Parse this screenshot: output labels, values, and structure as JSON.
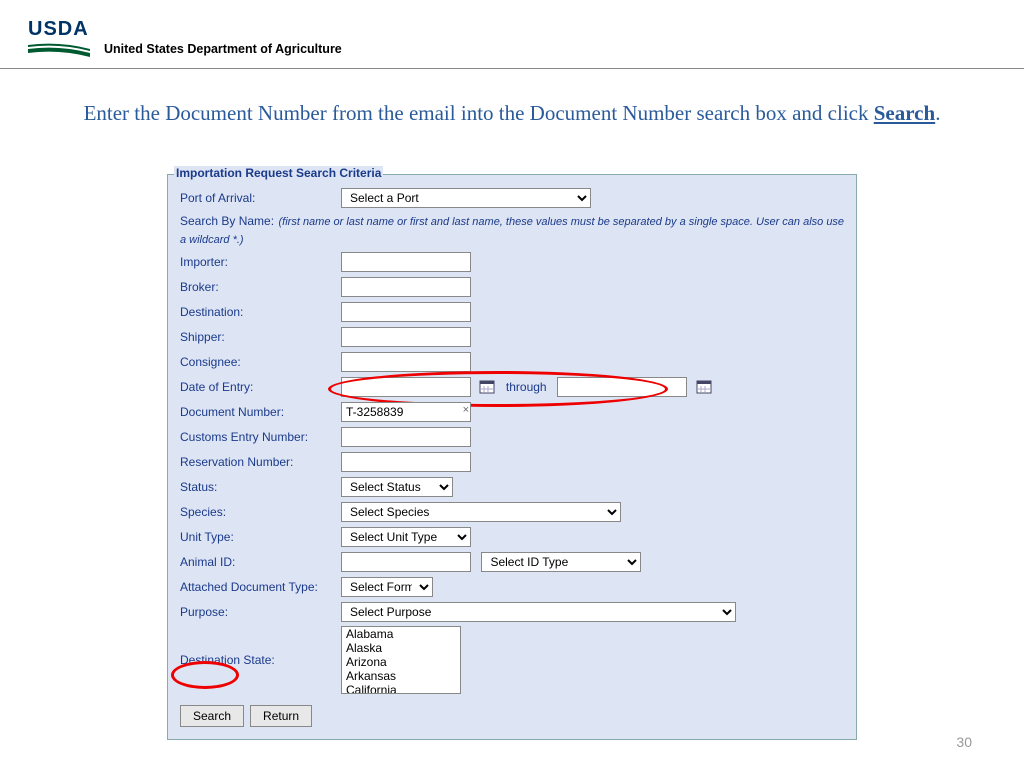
{
  "header": {
    "logo_text": "USDA",
    "dept": "United States Department of Agriculture"
  },
  "instruction": {
    "prefix": "Enter the Document Number from the email into the Document Number search box and click ",
    "search": "Search",
    "suffix": "."
  },
  "panel": {
    "legend": "Importation Request Search Criteria",
    "labels": {
      "port": "Port of Arrival:",
      "search_by_name": "Search By Name:",
      "hint": "(first name or last name or first and last name, these values must be separated by a single space. User can also use a wildcard *.)",
      "importer": "Importer:",
      "broker": "Broker:",
      "destination": "Destination:",
      "shipper": "Shipper:",
      "consignee": "Consignee:",
      "date_of_entry": "Date of Entry:",
      "through": "through",
      "doc_number": "Document Number:",
      "customs_entry": "Customs Entry Number:",
      "reservation": "Reservation Number:",
      "status": "Status:",
      "species": "Species:",
      "unit_type": "Unit Type:",
      "animal_id": "Animal ID:",
      "attached_doc": "Attached Document Type:",
      "purpose": "Purpose:",
      "dest_state": "Destination State:"
    },
    "values": {
      "doc_number": "T-3258839"
    },
    "selects": {
      "port": "Select a Port",
      "status": "Select Status",
      "species": "Select Species",
      "unit_type": "Select Unit Type",
      "id_type": "Select ID Type",
      "form": "Select Form",
      "purpose": "Select Purpose"
    },
    "states": [
      "Alabama",
      "Alaska",
      "Arizona",
      "Arkansas",
      "California"
    ],
    "buttons": {
      "search": "Search",
      "return": "Return"
    }
  },
  "page_number": "30"
}
